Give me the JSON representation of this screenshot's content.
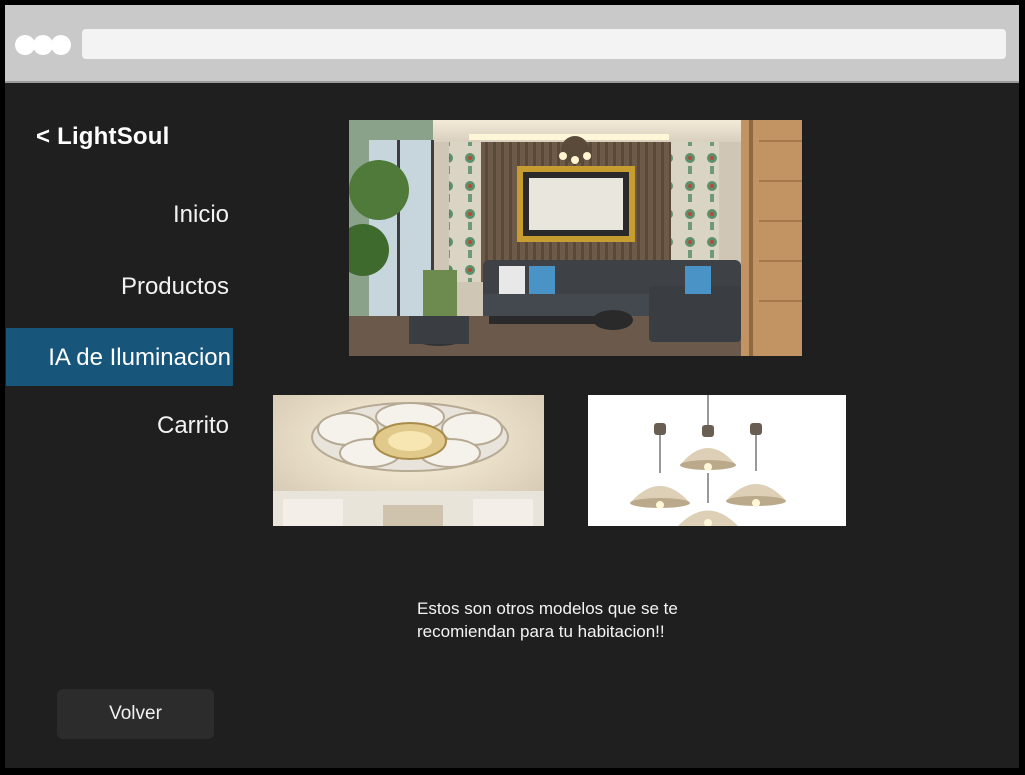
{
  "app": {
    "back_brand": "< LightSoul"
  },
  "nav": {
    "items": [
      {
        "label": "Inicio"
      },
      {
        "label": "Productos"
      },
      {
        "label": "IA de Iluminacion"
      },
      {
        "label": "Carrito"
      }
    ],
    "active_index": 2,
    "active_color": "#17567a"
  },
  "main": {
    "recommendation_text": "Estos son otros modelos que se te recomiendan para tu habitacion!!",
    "images": [
      {
        "name": "living-room-image"
      },
      {
        "name": "flower-ceiling-light-image"
      },
      {
        "name": "pendant-lamps-image"
      }
    ]
  },
  "footer": {
    "back_button_label": "Volver"
  },
  "colors": {
    "background": "#1f1f1f",
    "chrome": "#c9c9c9",
    "button_bg": "#2c2c2c"
  }
}
